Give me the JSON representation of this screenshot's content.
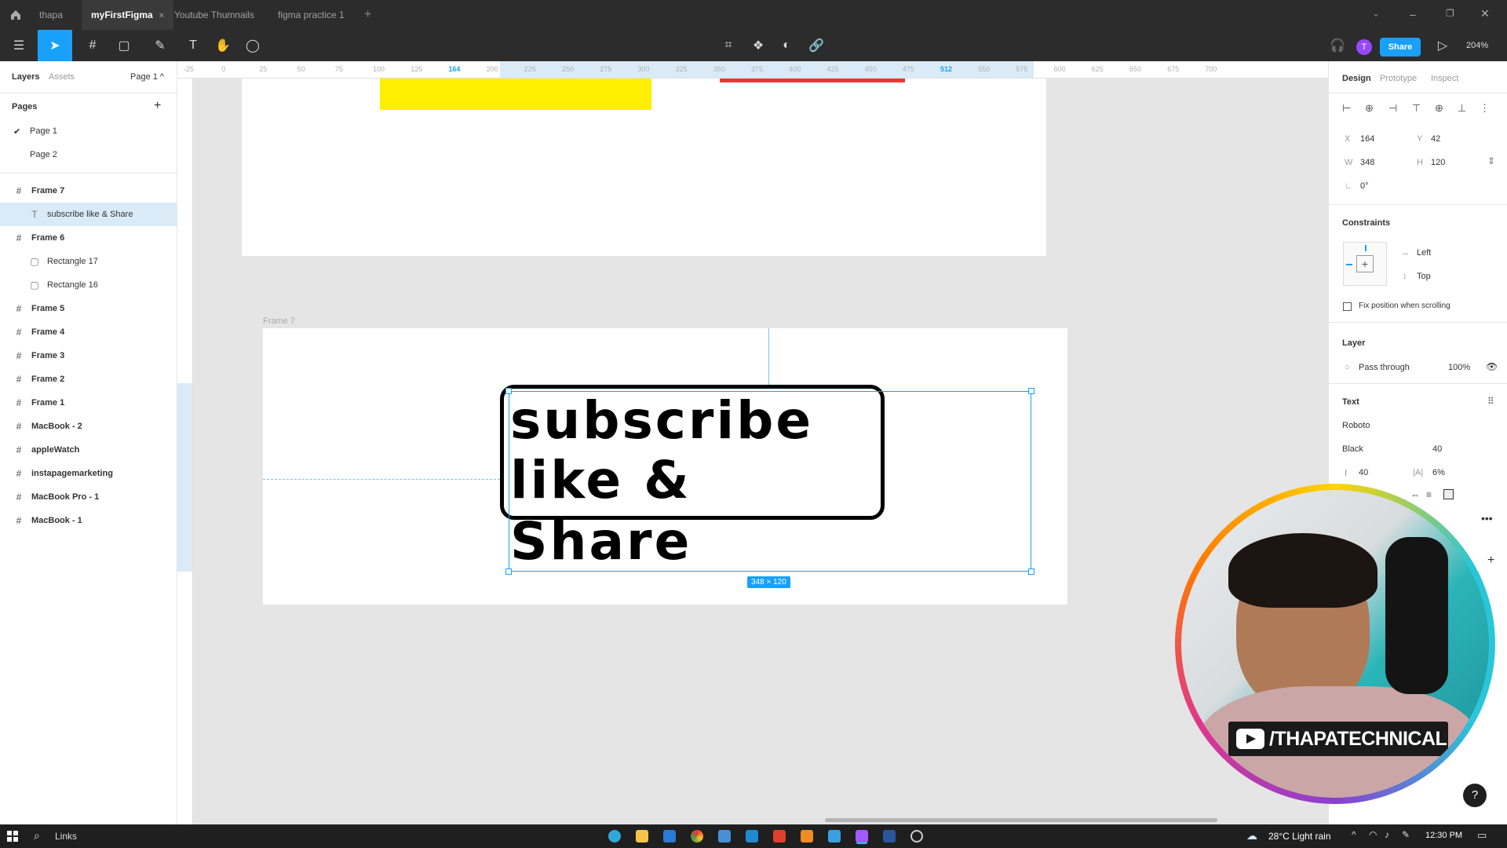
{
  "tabs": [
    {
      "label": "thapa"
    },
    {
      "label": "myFirstFigma",
      "active": true,
      "close": "×"
    },
    {
      "label": "Youtube Thumnails"
    },
    {
      "label": "figma practice 1"
    }
  ],
  "toolbar": {
    "avatar_initial": "T",
    "share_label": "Share",
    "zoom": "204%"
  },
  "left_panel": {
    "tabs": {
      "layers": "Layers",
      "assets": "Assets",
      "page_menu": "Page 1 ^"
    },
    "pages_title": "Pages",
    "add_page": "+",
    "pages": [
      {
        "label": "Page 1",
        "current": true
      },
      {
        "label": "Page 2"
      }
    ],
    "layers": [
      {
        "label": "Frame 7",
        "type": "frame"
      },
      {
        "label": "subscribe like & Share",
        "type": "text",
        "selected": true
      },
      {
        "label": "Frame 6",
        "type": "frame"
      },
      {
        "label": "Rectangle 17",
        "type": "rect"
      },
      {
        "label": "Rectangle 16",
        "type": "rect"
      },
      {
        "label": "Frame 5",
        "type": "frame"
      },
      {
        "label": "Frame 4",
        "type": "frame"
      },
      {
        "label": "Frame 3",
        "type": "frame"
      },
      {
        "label": "Frame 2",
        "type": "frame"
      },
      {
        "label": "Frame 1",
        "type": "frame"
      },
      {
        "label": "MacBook - 2",
        "type": "frame"
      },
      {
        "label": "appleWatch",
        "type": "frame"
      },
      {
        "label": "instapagemarketing",
        "type": "frame"
      },
      {
        "label": "MacBook Pro - 1",
        "type": "frame"
      },
      {
        "label": "MacBook - 1",
        "type": "frame"
      }
    ]
  },
  "ruler": {
    "top_ticks": [
      "-25",
      "0",
      "25",
      "50",
      "75",
      "100",
      "125",
      "164",
      "200",
      "225",
      "250",
      "275",
      "300",
      "325",
      "350",
      "375",
      "400",
      "425",
      "450",
      "475",
      "512",
      "550",
      "575",
      "600",
      "625",
      "650",
      "675",
      "700"
    ],
    "highlight_start": "164",
    "highlight_end": "512"
  },
  "canvas": {
    "frame_label": "Frame 7",
    "text_line1": "subscribe",
    "text_line2": "like & Share",
    "size_badge": "348 × 120",
    "colors": {
      "yellow": "#ffee00",
      "red": "#e53935",
      "selection": "#18a0fb"
    }
  },
  "right_panel": {
    "tabs": {
      "design": "Design",
      "prototype": "Prototype",
      "inspect": "Inspect"
    },
    "x_label": "X",
    "x": "164",
    "y_label": "Y",
    "y": "42",
    "w_label": "W",
    "w": "348",
    "h_label": "H",
    "h": "120",
    "rotation": "0°",
    "constraints_title": "Constraints",
    "constraint_h": "Left",
    "constraint_v": "Top",
    "fix_position": "Fix position when scrolling",
    "layer_title": "Layer",
    "blend": "Pass through",
    "opacity": "100%",
    "text_title": "Text",
    "font": "Roboto",
    "weight": "Black",
    "font_size": "40",
    "line_height": "40",
    "letter_spacing": "6%"
  },
  "webcam": {
    "handle": "/THAPATECHNICAL"
  },
  "taskbar": {
    "search": "Links",
    "weather": "28°C Light rain",
    "time": "12:30 PM"
  }
}
